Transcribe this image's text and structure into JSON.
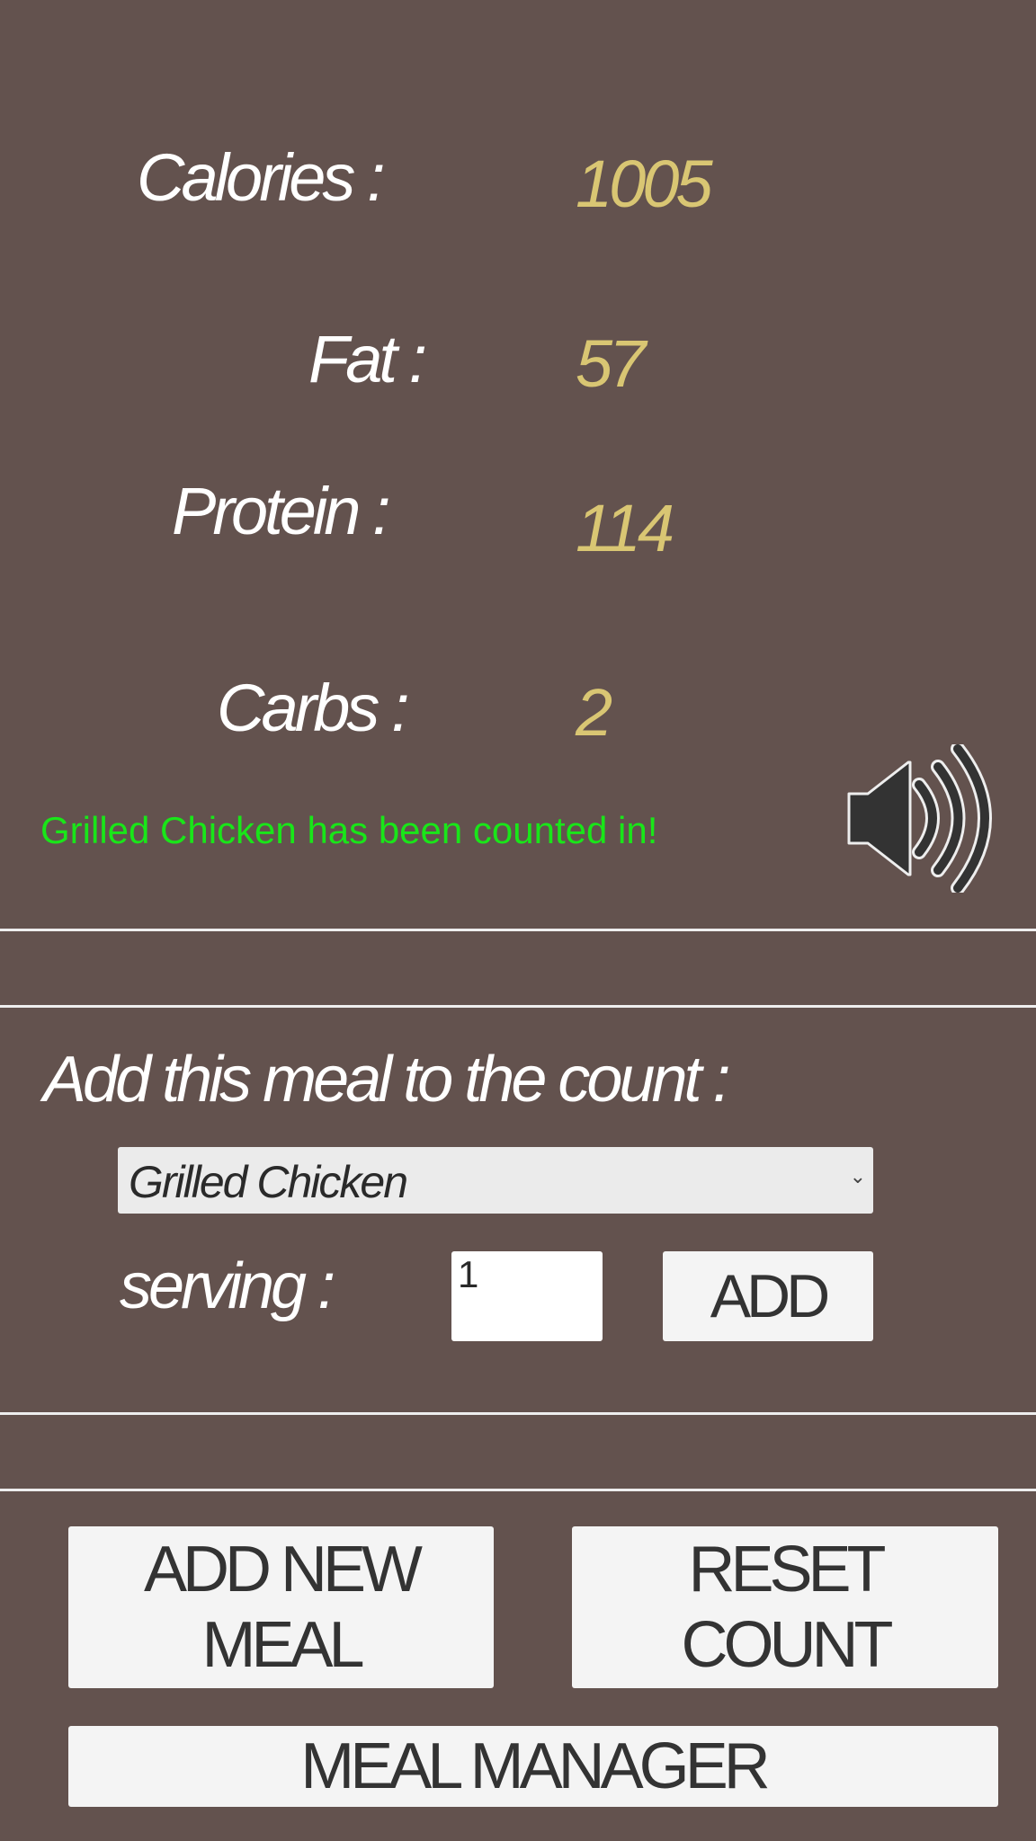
{
  "stats": [
    {
      "label": "Calories :",
      "value": "1005"
    },
    {
      "label": "Fat :",
      "value": "57"
    },
    {
      "label": "Protein :",
      "value": "114"
    },
    {
      "label": "Carbs :",
      "value": "2"
    }
  ],
  "status_message": "Grilled Chicken has been counted in!",
  "sound_icon": "speaker-volume-icon",
  "add_meal": {
    "heading": "Add this meal to the count :",
    "selected_meal": "Grilled Chicken",
    "serving_label": "serving :",
    "serving_value": "1",
    "add_button": "ADD"
  },
  "buttons": {
    "add_new_meal_line1": "ADD NEW",
    "add_new_meal_line2": "MEAL",
    "reset_count_line1": "RESET",
    "reset_count_line2": "COUNT",
    "meal_manager": "MEAL MANAGER"
  },
  "colors": {
    "background": "#63524e",
    "value": "#d9c673",
    "status": "#19e619",
    "button": "#f4f4f4"
  }
}
